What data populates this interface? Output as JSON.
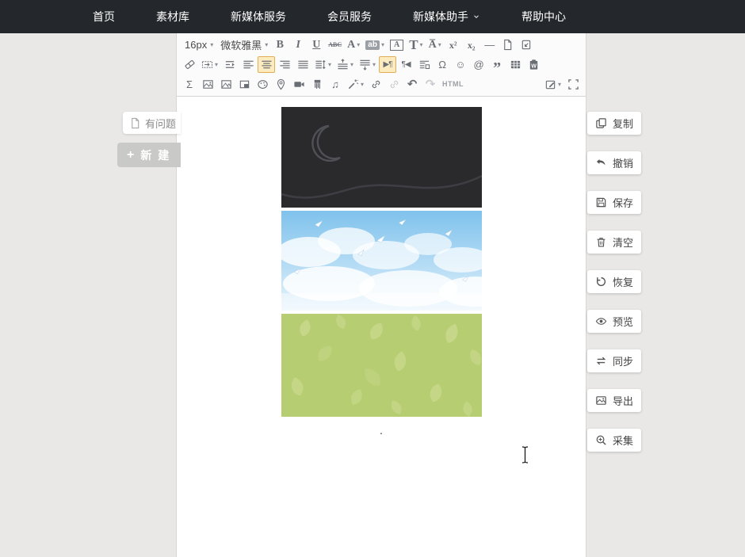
{
  "nav": {
    "items": [
      {
        "id": "home",
        "label": "首页"
      },
      {
        "id": "material-library",
        "label": "素材库"
      },
      {
        "id": "new-media-services",
        "label": "新媒体服务"
      },
      {
        "id": "member-services",
        "label": "会员服务"
      },
      {
        "id": "new-media-assistant",
        "label": "新媒体助手",
        "dropdown": true
      },
      {
        "id": "help-center",
        "label": "帮助中心"
      }
    ]
  },
  "left_actions": [
    {
      "id": "feedback",
      "label": "有问题",
      "icon": "doc"
    },
    {
      "id": "create-new",
      "label": "新 建",
      "icon": "plus"
    }
  ],
  "right_actions": [
    {
      "id": "copy",
      "label": "复制",
      "icon": "copy"
    },
    {
      "id": "undo",
      "label": "撤销",
      "icon": "undo-arrow"
    },
    {
      "id": "save",
      "label": "保存",
      "icon": "floppy"
    },
    {
      "id": "clear",
      "label": "清空",
      "icon": "trash"
    },
    {
      "id": "restore",
      "label": "恢复",
      "icon": "restore"
    },
    {
      "id": "preview",
      "label": "预览",
      "icon": "eye"
    },
    {
      "id": "sync",
      "label": "同步",
      "icon": "sync"
    },
    {
      "id": "export",
      "label": "导出",
      "icon": "picture"
    },
    {
      "id": "collect",
      "label": "采集",
      "icon": "magnifier-plus"
    }
  ],
  "toolbar": {
    "rows": [
      [
        {
          "id": "font-size",
          "text": "16px",
          "dropdown": true
        },
        {
          "id": "font-family",
          "text": "微软雅黑",
          "dropdown": true
        },
        {
          "id": "bold",
          "glyph": "B",
          "cls": "g-serif"
        },
        {
          "id": "italic",
          "glyph": "I",
          "cls": "g-serif g-italic"
        },
        {
          "id": "underline",
          "glyph": "U",
          "cls": "g-serif g-under"
        },
        {
          "id": "strikethrough",
          "glyph": "ABC",
          "cls": "g-abc"
        },
        {
          "id": "font-color",
          "glyph": "A",
          "cls": "g-serif",
          "dropdown": true
        },
        {
          "id": "highlight-color",
          "glyph": "ab",
          "cls": "g-ab",
          "dropdown": true
        },
        {
          "id": "border-color",
          "glyph": "A",
          "cls": "g-boxed"
        },
        {
          "id": "title-style",
          "glyph": "T",
          "cls": "g-serif g-T",
          "dropdown": true
        },
        {
          "id": "letter-spacing",
          "glyph": "A̅",
          "cls": "g-serif",
          "dropdown": true
        },
        {
          "id": "superscript",
          "glyph": "x²",
          "cls": "g-serif g-script"
        },
        {
          "id": "subscript",
          "glyph": "x₂",
          "cls": "g-serif g-script"
        },
        {
          "id": "horizontal-rule",
          "glyph": "—"
        },
        {
          "id": "new-document",
          "icon": "doc"
        },
        {
          "id": "draft-import",
          "icon": "doc-in"
        }
      ],
      [
        {
          "id": "format-eraser",
          "icon": "eraser"
        },
        {
          "id": "first-line-indent",
          "icon": "indent",
          "dropdown": true
        },
        {
          "id": "indent-paragraph",
          "icon": "outdent"
        },
        {
          "id": "align-left",
          "icon": "bars-left"
        },
        {
          "id": "align-center",
          "icon": "bars-center",
          "active": true
        },
        {
          "id": "align-right",
          "icon": "bars-right"
        },
        {
          "id": "align-justify",
          "icon": "bars-justify"
        },
        {
          "id": "line-height",
          "icon": "bars-lh",
          "dropdown": true
        },
        {
          "id": "space-before",
          "icon": "bars-up",
          "dropdown": true
        },
        {
          "id": "space-after",
          "icon": "bars-down",
          "dropdown": true
        },
        {
          "id": "direction-ltr",
          "glyph": "▶¶",
          "cls": "g-dir",
          "active": true
        },
        {
          "id": "direction-rtl",
          "glyph": "¶◀",
          "cls": "g-dir"
        },
        {
          "id": "paragraph-merge",
          "icon": "merge"
        },
        {
          "id": "special-character",
          "glyph": "Ω"
        },
        {
          "id": "emoticon",
          "glyph": "☺"
        },
        {
          "id": "anchor-link",
          "glyph": "@"
        },
        {
          "id": "blockquote",
          "glyph": "”",
          "cls": "g-quote"
        },
        {
          "id": "insert-table",
          "icon": "table"
        },
        {
          "id": "paste-from-word",
          "icon": "word"
        }
      ],
      [
        {
          "id": "formula",
          "glyph": "Σ"
        },
        {
          "id": "insert-image",
          "icon": "image"
        },
        {
          "id": "image-manager",
          "icon": "image2"
        },
        {
          "id": "page-background",
          "icon": "frame"
        },
        {
          "id": "emotion-palette",
          "icon": "palette"
        },
        {
          "id": "insert-map",
          "icon": "pin"
        },
        {
          "id": "insert-video",
          "icon": "video"
        },
        {
          "id": "format-brush",
          "icon": "brush"
        },
        {
          "id": "insert-music",
          "glyph": "♫"
        },
        {
          "id": "one-key-format",
          "icon": "wand",
          "dropdown": true
        },
        {
          "id": "insert-link",
          "icon": "link"
        },
        {
          "id": "remove-link",
          "icon": "link",
          "disabled": true
        },
        {
          "id": "undo-edit",
          "glyph": "↶",
          "cls": "g-undo"
        },
        {
          "id": "redo-edit",
          "glyph": "↷",
          "cls": "g-undo",
          "disabled": true
        },
        {
          "id": "view-html",
          "glyph": "HTML",
          "cls": "g-html"
        },
        {
          "id": "edit-mode",
          "icon": "edit",
          "dropdown": true,
          "right": true
        },
        {
          "id": "fullscreen",
          "icon": "fullscreen"
        }
      ]
    ]
  },
  "editor": {
    "trailing_text": "."
  },
  "colors": {
    "nav_bg": "#24282c",
    "page_bg": "#eae8e6",
    "toolbar_active_bg": "#fdecc0",
    "toolbar_active_border": "#e0ae56",
    "icon_gray": "#6a6e74",
    "night_image_bg": "#2a2a2d",
    "sky_image_top": "#7fc2ec",
    "grass_image_bg": "#b7cd72"
  }
}
